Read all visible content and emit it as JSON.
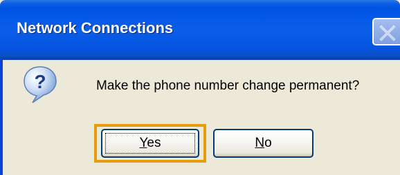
{
  "window": {
    "title": "Network Connections",
    "close_icon": "close-icon"
  },
  "dialog": {
    "icon": "question-icon",
    "message": "Make the phone number change permanent?"
  },
  "buttons": {
    "yes": {
      "accel": "Y",
      "rest": "es"
    },
    "no": {
      "accel": "N",
      "rest": "o"
    }
  },
  "colors": {
    "titlebar": "#0054e3",
    "face": "#ece9d8",
    "focus": "#e89c0c",
    "button_border": "#003c74"
  }
}
